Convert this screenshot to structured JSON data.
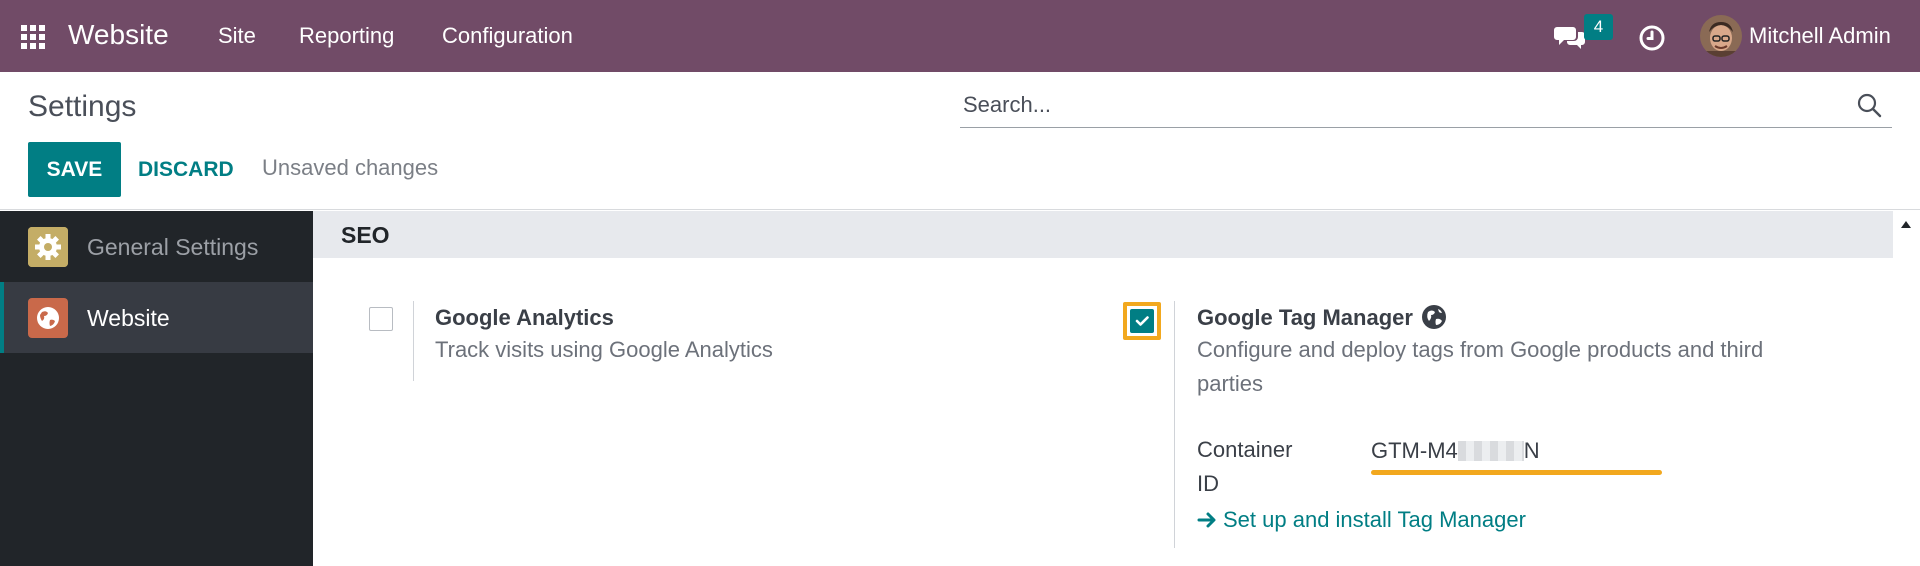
{
  "navbar": {
    "app_icon": "apps-grid-icon",
    "brand": "Website",
    "menu": [
      {
        "label": "Site"
      },
      {
        "label": "Reporting"
      },
      {
        "label": "Configuration"
      }
    ],
    "chat_icon": "chat-bubbles-icon",
    "chat_badge": "4",
    "activity_icon": "clock-icon",
    "user_name": "Mitchell Admin"
  },
  "control_panel": {
    "title": "Settings",
    "search_placeholder": "Search...",
    "save_label": "SAVE",
    "discard_label": "DISCARD",
    "status": "Unsaved changes"
  },
  "sidebar": {
    "items": [
      {
        "label": "General Settings",
        "icon": "gear-icon",
        "active": false
      },
      {
        "label": "Website",
        "icon": "website-globe-icon",
        "active": true
      }
    ]
  },
  "section": {
    "title": "SEO",
    "settings": [
      {
        "title": "Google Analytics",
        "description": "Track visits using Google Analytics",
        "checked": false
      },
      {
        "title": "Google Tag Manager",
        "description_line1": "Configure and deploy tags from Google products and third",
        "description_line2": "parties",
        "checked": true,
        "field_label_line1": "Container",
        "field_label_line2": "ID",
        "container_id_prefix": "GTM-M4",
        "container_id_suffix": "N",
        "link_label": "Set up and install Tag Manager"
      }
    ]
  },
  "colors": {
    "navbar": "#714b67",
    "primary": "#017e84",
    "highlight": "#f2a81e",
    "sidebar_bg": "#212529"
  }
}
